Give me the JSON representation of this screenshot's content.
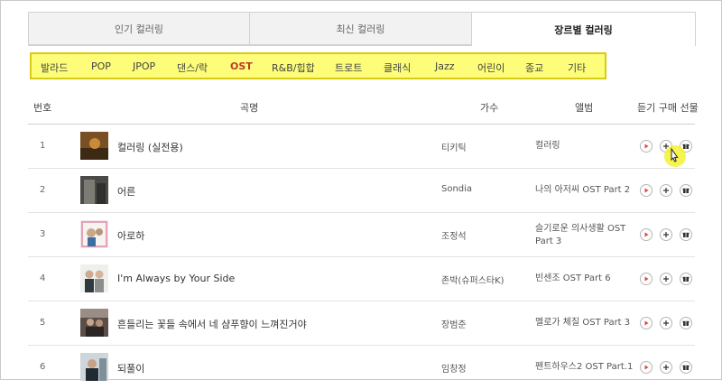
{
  "tabs": [
    {
      "label": "인기 컬러링"
    },
    {
      "label": "최신 컬러링"
    },
    {
      "label": "장르별 컬러링"
    }
  ],
  "genres": [
    "발라드",
    "POP",
    "JPOP",
    "댄스/락",
    "OST",
    "R&B/힙합",
    "트로트",
    "클래식",
    "Jazz",
    "어린이",
    "종교",
    "기타"
  ],
  "active_genre": "OST",
  "table": {
    "headers": {
      "num": "번호",
      "title": "곡명",
      "artist": "가수",
      "album": "앨범",
      "actions": "듣기 구매 선물"
    },
    "rows": [
      {
        "num": "1",
        "title": "컬러링 (실전용)",
        "artist": "티키틱",
        "album": "컬러링"
      },
      {
        "num": "2",
        "title": "어른",
        "artist": "Sondia",
        "album": "나의 아저씨 OST Part 2"
      },
      {
        "num": "3",
        "title": "아로하",
        "artist": "조정석",
        "album_line1": "슬기로운 의사생활 OST",
        "album_line2": "Part 3"
      },
      {
        "num": "4",
        "title": "I'm Always by Your Side",
        "artist": "존박(슈퍼스타K)",
        "album": "빈센조 OST Part 6"
      },
      {
        "num": "5",
        "title": "흔들리는 꽃들 속에서 네 샴푸향이 느껴진거야",
        "artist": "장범준",
        "album": "멜로가 체질 OST Part 3"
      },
      {
        "num": "6",
        "title": "되풀이",
        "artist": "임창정",
        "album": "펜트하우스2 OST Part.1"
      }
    ]
  },
  "colors": {
    "active_genre": "#c0392b",
    "highlight": "#fdfd7a",
    "play_icon": "#e0453a"
  }
}
